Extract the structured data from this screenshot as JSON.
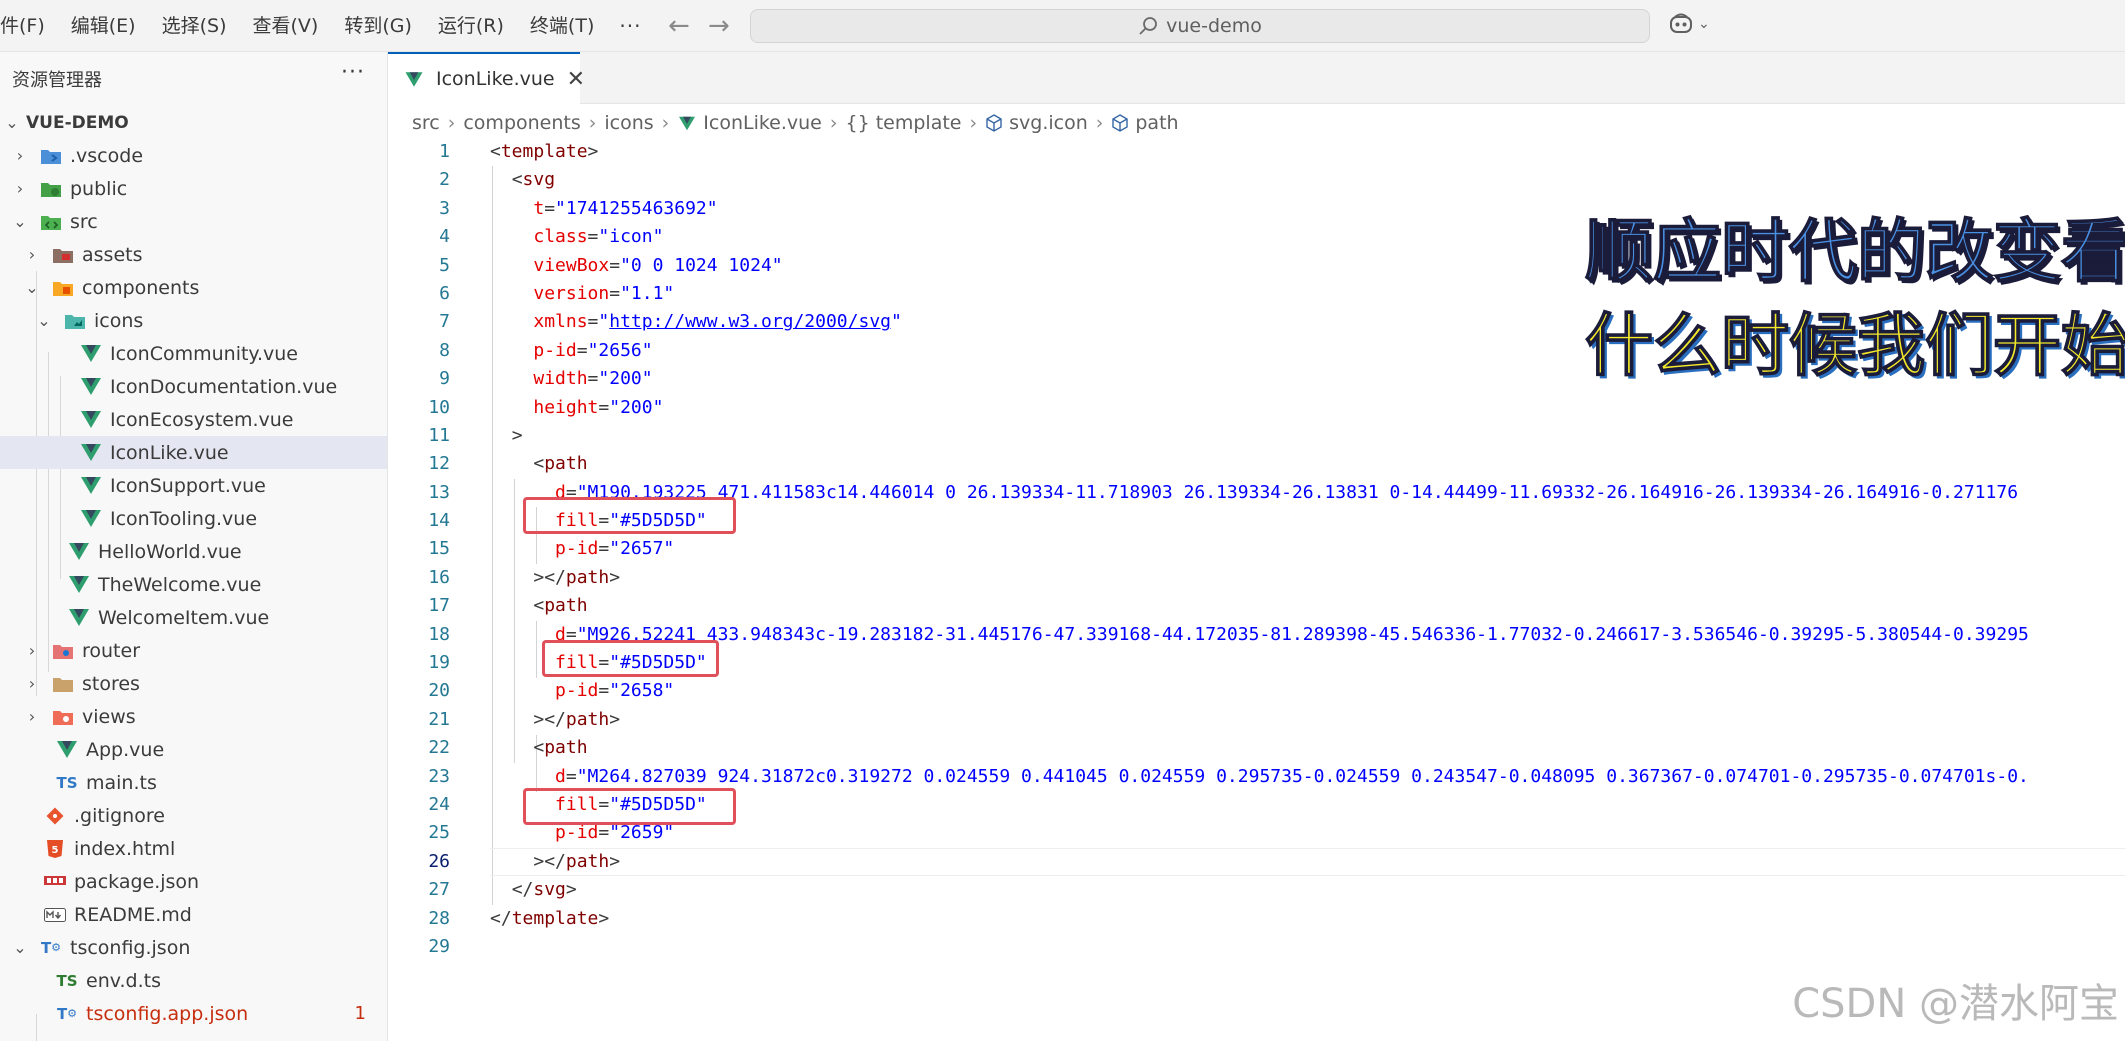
{
  "menu": {
    "items": [
      "件(F)",
      "编辑(E)",
      "选择(S)",
      "查看(V)",
      "转到(G)",
      "运行(R)",
      "终端(T)"
    ],
    "more": "···"
  },
  "command_center": {
    "text": "vue-demo",
    "icon": "search-icon"
  },
  "sidebar": {
    "header": "资源管理器",
    "more": "···",
    "root": "VUE-DEMO",
    "items": [
      {
        "label": ".vscode",
        "icon": "vscode-folder-icon"
      },
      {
        "label": "public",
        "icon": "public-folder-icon"
      },
      {
        "label": "src",
        "icon": "src-folder-icon"
      },
      {
        "label": "assets",
        "icon": "assets-folder-icon"
      },
      {
        "label": "components",
        "icon": "components-folder-icon"
      },
      {
        "label": "icons",
        "icon": "icons-folder-icon"
      },
      {
        "label": "IconCommunity.vue",
        "icon": "vue-file-icon"
      },
      {
        "label": "IconDocumentation.vue",
        "icon": "vue-file-icon"
      },
      {
        "label": "IconEcosystem.vue",
        "icon": "vue-file-icon"
      },
      {
        "label": "IconLike.vue",
        "icon": "vue-file-icon"
      },
      {
        "label": "IconSupport.vue",
        "icon": "vue-file-icon"
      },
      {
        "label": "IconTooling.vue",
        "icon": "vue-file-icon"
      },
      {
        "label": "HelloWorld.vue",
        "icon": "vue-file-icon"
      },
      {
        "label": "TheWelcome.vue",
        "icon": "vue-file-icon"
      },
      {
        "label": "WelcomeItem.vue",
        "icon": "vue-file-icon"
      },
      {
        "label": "router",
        "icon": "router-folder-icon"
      },
      {
        "label": "stores",
        "icon": "folder-icon"
      },
      {
        "label": "views",
        "icon": "views-folder-icon"
      },
      {
        "label": "App.vue",
        "icon": "vue-file-icon"
      },
      {
        "label": "main.ts",
        "icon": "ts-file-icon"
      },
      {
        "label": ".gitignore",
        "icon": "git-icon"
      },
      {
        "label": "index.html",
        "icon": "html-icon"
      },
      {
        "label": "package.json",
        "icon": "npm-icon"
      },
      {
        "label": "README.md",
        "icon": "markdown-icon"
      },
      {
        "label": "tsconfig.json",
        "icon": "tsconfig-icon"
      },
      {
        "label": "env.d.ts",
        "icon": "ts-file-icon"
      },
      {
        "label": "tsconfig.app.json",
        "icon": "tsconfig-icon",
        "badge": "1"
      }
    ]
  },
  "tab": {
    "label": "IconLike.vue",
    "close": "✕"
  },
  "breadcrumb": [
    "src",
    "components",
    "icons",
    "IconLike.vue",
    "{} template",
    "svg.icon",
    "path"
  ],
  "code": [
    "<template>",
    "  <svg",
    "    t=\"1741255463692\"",
    "    class=\"icon\"",
    "    viewBox=\"0 0 1024 1024\"",
    "    version=\"1.1\"",
    "    xmlns=\"http://www.w3.org/2000/svg\"",
    "    p-id=\"2656\"",
    "    width=\"200\"",
    "    height=\"200\"",
    "  >",
    "    <path",
    "      d=\"M190.193225 471.411583c14.446014 0 26.139334-11.718903 26.139334-26.13831 0-14.44499-11.69332-26.164916-26.139334-26.164916-0.271176",
    "      fill=\"#5D5D5D\"",
    "      p-id=\"2657\"",
    "    ></path>",
    "    <path",
    "      d=\"M926.52241 433.948343c-19.283182-31.445176-47.339168-44.172035-81.289398-45.546336-1.77032-0.246617-3.536546-0.39295-5.380544-0.39295",
    "      fill=\"#5D5D5D\"",
    "      p-id=\"2658\"",
    "    ></path>",
    "    <path",
    "      d=\"M264.827039 924.31872c0.319272 0.024559 0.441045 0.024559 0.295735-0.024559 0.243547-0.048095 0.367367-0.074701-0.295735-0.074701s-0.",
    "      fill=\"#5D5D5D\"",
    "      p-id=\"2659\"",
    "    ></path>",
    "  </svg>",
    "</template>",
    ""
  ],
  "line_numbers": [
    "1",
    "2",
    "3",
    "4",
    "5",
    "6",
    "7",
    "8",
    "9",
    "10",
    "11",
    "12",
    "13",
    "14",
    "15",
    "16",
    "17",
    "18",
    "19",
    "20",
    "21",
    "22",
    "23",
    "24",
    "25",
    "26",
    "27",
    "28",
    "29"
  ],
  "overlay": {
    "line1": "顺应时代的改变看",
    "line2": "什么时候我们开始"
  },
  "watermark": "CSDN @潜水阿宝",
  "colors": {
    "accent": "#005fb8",
    "highlight_box": "#e0505a",
    "fill_value": "#5D5D5D"
  }
}
